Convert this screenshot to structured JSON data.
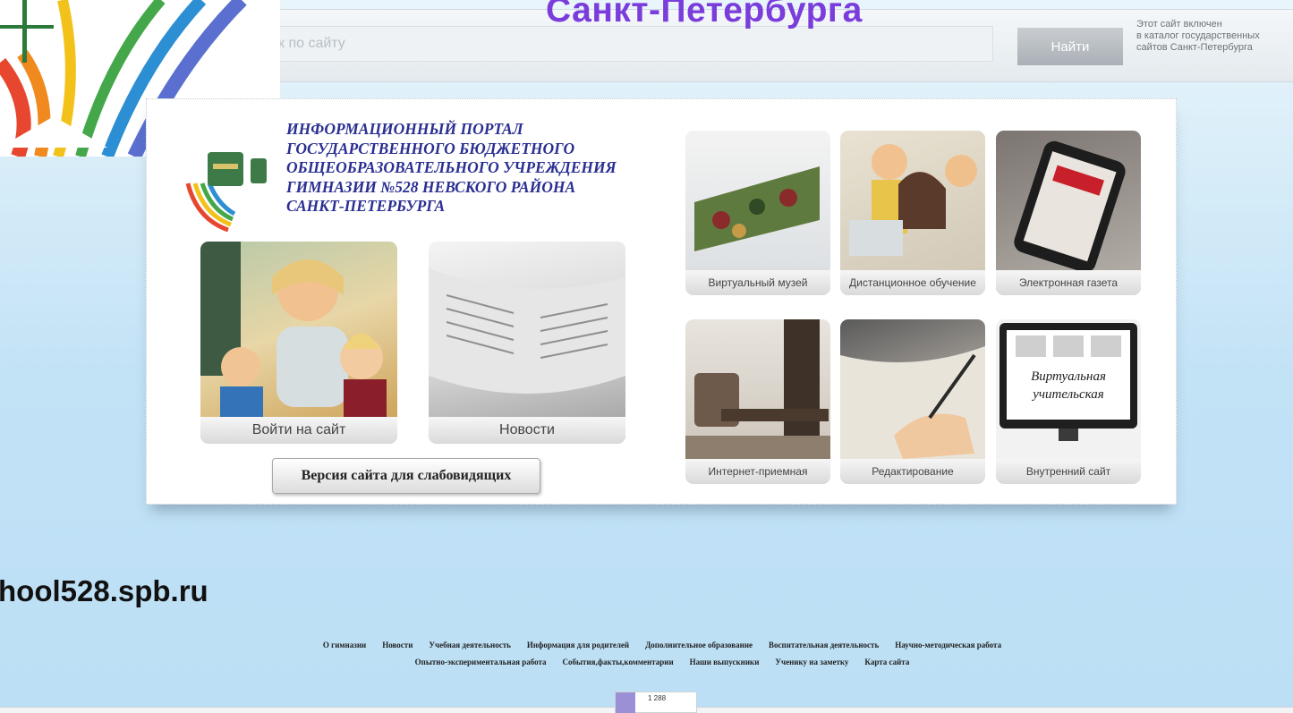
{
  "header": {
    "slide_heading": "Санкт-Петербурга",
    "search_placeholder": "к по сайту",
    "search_button": "Найти",
    "catalog_note": [
      "Этот сайт включен",
      "в каталог государственных",
      "сайтов Санкт-Петербурга"
    ]
  },
  "portal": {
    "title_lines": [
      "ИНФОРМАЦИОННЫЙ ПОРТАЛ",
      "ГОСУДАРСТВЕННОГО БЮДЖЕТНОГО",
      "ОБЩЕОБРАЗОВАТЕЛЬНОГО УЧРЕЖДЕНИЯ",
      "ГИМНАЗИИ №528 НЕВСКОГО РАЙОНА",
      "САНКТ-ПЕТЕРБУРГА"
    ],
    "login_tile": "Войти на сайт",
    "news_tile": "Новости",
    "low_vision_button": "Версия сайта для слабовидящих",
    "tiles": [
      "Виртуальный музей",
      "Дистанционное обучение",
      "Электронная газета",
      "Интернет-приемная",
      "Редактирование",
      "Внутренний сайт"
    ],
    "monitor_text": [
      "Виртуальная",
      "учительская"
    ]
  },
  "site_url": "hool528.spb.ru",
  "footer_nav": {
    "row1": [
      "О гимназии",
      "Новости",
      "Учебная деятельность",
      "Информация для родителей",
      "Дополнительное образование",
      "Воспитательная деятельность",
      "Научно-методическая работа"
    ],
    "row2": [
      "Опытно-экспериментальная работа",
      "События,факты,комментарии",
      "Наши выпускники",
      "Ученику на заметку",
      "Карта сайта"
    ]
  },
  "counter": {
    "value": "1 288"
  },
  "colors": {
    "heading": "#7a3ddc",
    "portal_title": "#2a2f91"
  }
}
